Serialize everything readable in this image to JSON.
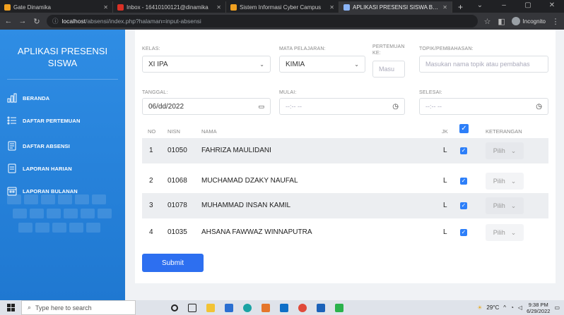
{
  "browser": {
    "tabs": [
      {
        "title": "Gate Dinamika",
        "color": "#f0a020",
        "active": false
      },
      {
        "title": "Inbox - 16410100121@dinamika",
        "color": "#d93025",
        "active": false
      },
      {
        "title": "Sistem Informasi Cyber Campus",
        "color": "#f0a020",
        "active": false
      },
      {
        "title": "APLIKASI PRESENSI SISWA BERB",
        "color": "#8ab4f8",
        "active": true
      }
    ],
    "url_host": "localhost",
    "url_path": "/absensi/index.php?halaman=input-absensi",
    "incognito_label": "Incognito"
  },
  "sidebar": {
    "title_line1": "APLIKASI PRESENSI",
    "title_line2": "SISWA",
    "items": [
      {
        "label": "BERANDA",
        "icon": "bar-chart-icon"
      },
      {
        "label": "DAFTAR PERTEMUAN",
        "icon": "list-icon"
      },
      {
        "label": "DAFTAR ABSENSI",
        "icon": "document-icon"
      },
      {
        "label": "LAPORAN HARIAN",
        "icon": "report-icon"
      },
      {
        "label": "LAPORAN BULANAN",
        "icon": "calendar-icon"
      }
    ]
  },
  "form": {
    "kelas_label": "KELAS:",
    "kelas_value": "XI IPA",
    "mapel_label": "MATA PELAJARAN:",
    "mapel_value": "KIMIA",
    "pertemuan_label_1": "PERTEMUAN",
    "pertemuan_label_2": "KE:",
    "pertemuan_placeholder": "Masu",
    "topik_label": "TOPIK/PEMBAHASAN:",
    "topik_placeholder": "Masukan nama topik atau pembahas",
    "tanggal_label": "TANGGAL:",
    "tanggal_value": "06/dd/2022",
    "mulai_label": "MULAI:",
    "mulai_value": "--:-- --",
    "selesai_label": "SELESAI:",
    "selesai_value": "--:-- --"
  },
  "table": {
    "headers": {
      "no": "NO",
      "nisn": "NISN",
      "nama": "NAMA",
      "jk": "JK",
      "keterangan": "KETERANGAN"
    },
    "select_placeholder": "Pilih",
    "rows": [
      {
        "no": "1",
        "nisn": "01050",
        "nama": "FAHRIZA MAULIDANI",
        "jk": "L"
      },
      {
        "no": "2",
        "nisn": "01068",
        "nama": "MUCHAMAD DZAKY NAUFAL",
        "jk": "L"
      },
      {
        "no": "3",
        "nisn": "01078",
        "nama": "MUHAMMAD INSAN KAMIL",
        "jk": "L"
      },
      {
        "no": "4",
        "nisn": "01035",
        "nama": "AHSANA FAWWAZ WINNAPUTRA",
        "jk": "L"
      }
    ]
  },
  "submit_label": "Submit",
  "taskbar": {
    "search_placeholder": "Type here to search",
    "weather": "29°C",
    "time": "9:38 PM",
    "date": "6/29/2022"
  },
  "colors": {
    "sidebar": "#2f8de4",
    "accent": "#2d6ff0",
    "checkbox": "#2d7ff9"
  }
}
